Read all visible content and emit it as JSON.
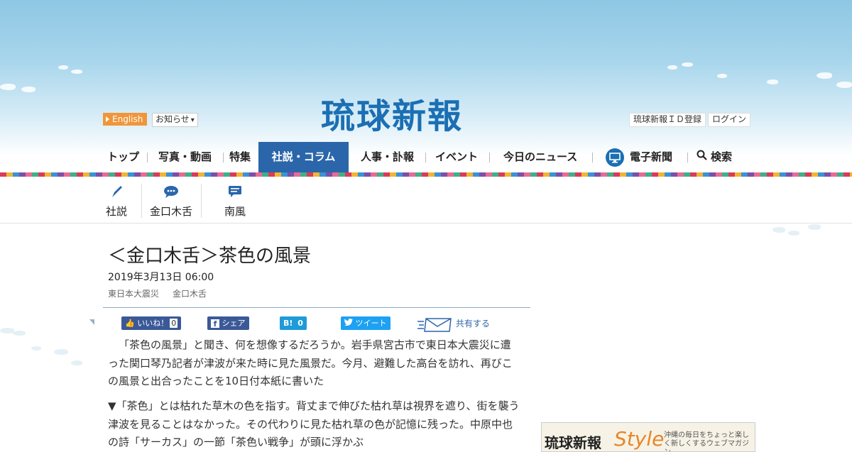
{
  "header": {
    "logo": "琉球新報",
    "lang_button": "English",
    "notice_button": "お知らせ",
    "register_link": "琉球新報ＩＤ登録",
    "login_link": "ログイン"
  },
  "nav": {
    "items": [
      {
        "label": "トップ"
      },
      {
        "label": "写真・動画"
      },
      {
        "label": "特集"
      },
      {
        "label": "社説・コラム",
        "active": true
      },
      {
        "label": "人事・訃報"
      },
      {
        "label": "イベント"
      },
      {
        "label": "今日のニュース"
      },
      {
        "label": "電子新聞",
        "icon": "monitor-icon"
      },
      {
        "label": "検索",
        "icon": "search-icon"
      }
    ]
  },
  "subnav": {
    "items": [
      {
        "label": "社説",
        "icon": "pen-icon"
      },
      {
        "label": "金口木舌",
        "icon": "speech-bubble-icon"
      },
      {
        "label": "南風",
        "icon": "message-icon"
      }
    ]
  },
  "article": {
    "title": "＜金口木舌＞茶色の風景",
    "date": "2019年3月13日 06:00",
    "tags": [
      "東日本大震災",
      "金口木舌"
    ],
    "paragraphs": [
      "「茶色の風景」と聞き、何を想像するだろうか。岩手県宮古市で東日本大震災に遭った関口琴乃記者が津波が来た時に見た風景だ。今月、避難した高台を訪れ、再びこの風景と出合ったことを10日付本紙に書いた",
      "▼「茶色」とは枯れた草木の色を指す。背丈まで伸びた枯れ草は視界を遮り、街を襲う津波を見ることはなかった。その代わりに見た枯れ草の色が記憶に残った。中原中也の詩「サーカス」の一節「茶色い戦争」が頭に浮かぶ"
    ]
  },
  "share": {
    "like_label": "いいね！",
    "like_count": "0",
    "fb_share_label": "シェア",
    "hatena_label": "B!",
    "hatena_count": "0",
    "tweet_label": "ツイート",
    "share_all_label": "共有する"
  },
  "sidebar_ad": {
    "brand": "琉球新報",
    "style_word": "Style",
    "tagline": "沖縄の毎日をちょっと楽しく新しくするウェブマガジン"
  },
  "colors": {
    "brand_blue": "#1b6fb3",
    "nav_active": "#2b66aa",
    "lang_orange": "#f0953a",
    "facebook": "#3b5998",
    "hatena": "#1e9bd8",
    "twitter": "#1da1f2"
  }
}
